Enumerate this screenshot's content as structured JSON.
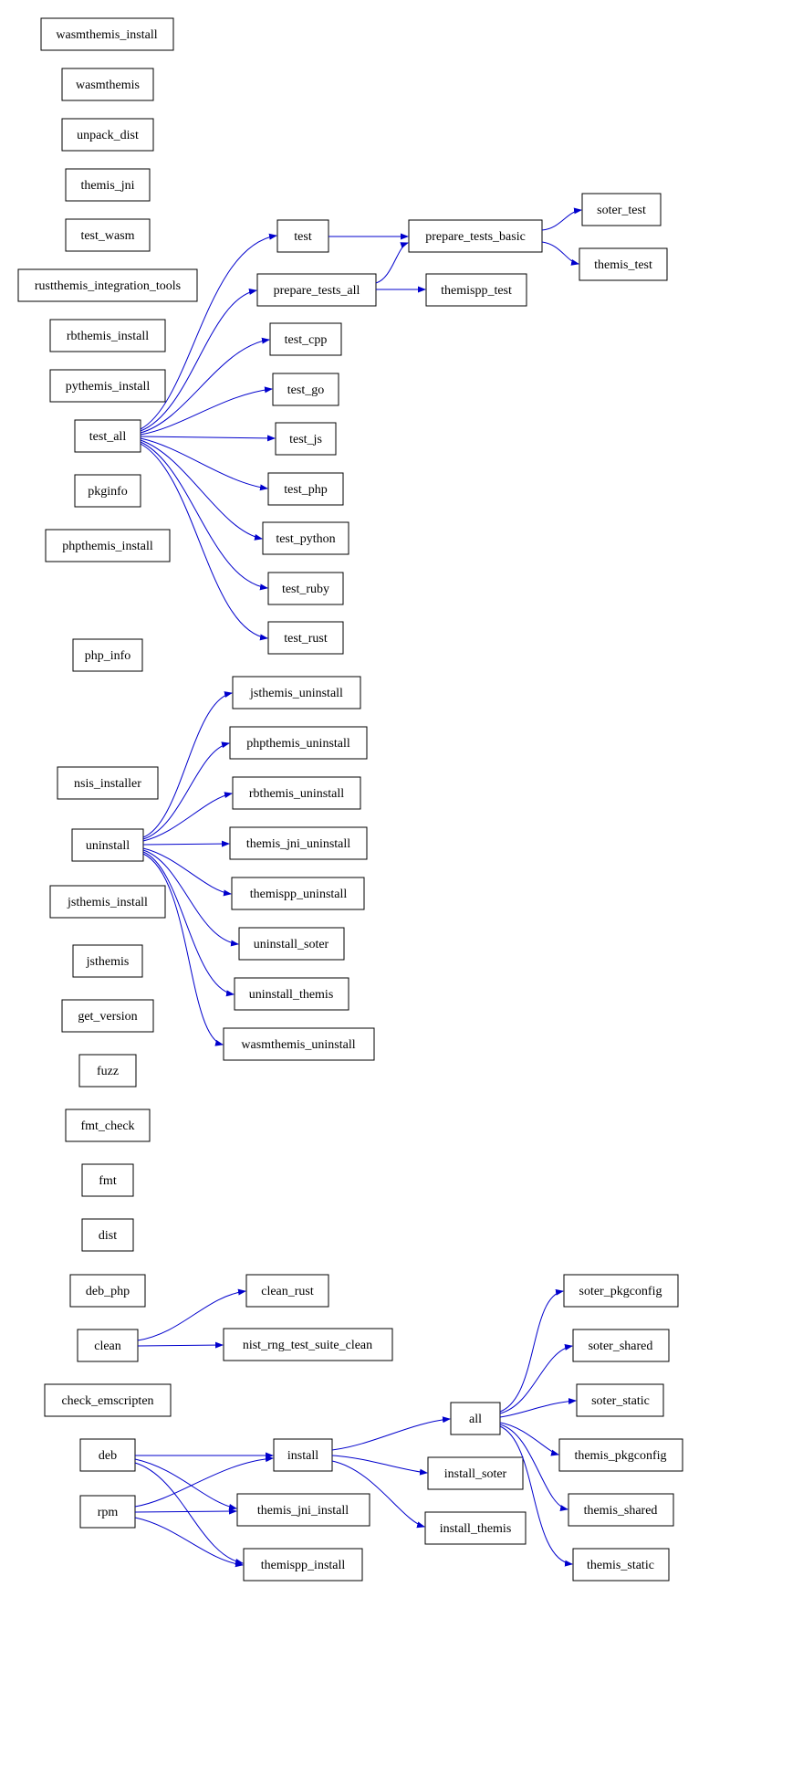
{
  "diagram_type": "dependency-graph",
  "nodes": {
    "wasmthemis_install": "wasmthemis_install",
    "wasmthemis": "wasmthemis",
    "unpack_dist": "unpack_dist",
    "themis_jni": "themis_jni",
    "test_wasm": "test_wasm",
    "rustthemis_integration_tools": "rustthemis_integration_tools",
    "rbthemis_install": "rbthemis_install",
    "pythemis_install": "pythemis_install",
    "test_all": "test_all",
    "pkginfo": "pkginfo",
    "phpthemis_install": "phpthemis_install",
    "test": "test",
    "prepare_tests_all": "prepare_tests_all",
    "test_cpp": "test_cpp",
    "test_go": "test_go",
    "test_js": "test_js",
    "test_php": "test_php",
    "test_python": "test_python",
    "test_ruby": "test_ruby",
    "test_rust": "test_rust",
    "prepare_tests_basic": "prepare_tests_basic",
    "themispp_test": "themispp_test",
    "soter_test": "soter_test",
    "themis_test": "themis_test",
    "php_info": "php_info",
    "nsis_installer": "nsis_installer",
    "uninstall": "uninstall",
    "jsthemis_install": "jsthemis_install",
    "jsthemis": "jsthemis",
    "get_version": "get_version",
    "fuzz": "fuzz",
    "fmt_check": "fmt_check",
    "fmt": "fmt",
    "dist": "dist",
    "deb_php": "deb_php",
    "clean": "clean",
    "check_emscripten": "check_emscripten",
    "deb": "deb",
    "rpm": "rpm",
    "jsthemis_uninstall": "jsthemis_uninstall",
    "phpthemis_uninstall": "phpthemis_uninstall",
    "rbthemis_uninstall": "rbthemis_uninstall",
    "themis_jni_uninstall": "themis_jni_uninstall",
    "themispp_uninstall": "themispp_uninstall",
    "uninstall_soter": "uninstall_soter",
    "uninstall_themis": "uninstall_themis",
    "wasmthemis_uninstall": "wasmthemis_uninstall",
    "clean_rust": "clean_rust",
    "nist_rng_test_suite_clean": "nist_rng_test_suite_clean",
    "install": "install",
    "themis_jni_install": "themis_jni_install",
    "themispp_install": "themispp_install",
    "all": "all",
    "install_soter": "install_soter",
    "install_themis": "install_themis",
    "soter_pkgconfig": "soter_pkgconfig",
    "soter_shared": "soter_shared",
    "soter_static": "soter_static",
    "themis_pkgconfig": "themis_pkgconfig",
    "themis_shared": "themis_shared",
    "themis_static": "themis_static"
  },
  "edges": [
    [
      "test_all",
      "test"
    ],
    [
      "test_all",
      "prepare_tests_all"
    ],
    [
      "test_all",
      "test_cpp"
    ],
    [
      "test_all",
      "test_go"
    ],
    [
      "test_all",
      "test_js"
    ],
    [
      "test_all",
      "test_php"
    ],
    [
      "test_all",
      "test_python"
    ],
    [
      "test_all",
      "test_ruby"
    ],
    [
      "test_all",
      "test_rust"
    ],
    [
      "test",
      "prepare_tests_basic"
    ],
    [
      "prepare_tests_all",
      "prepare_tests_basic"
    ],
    [
      "prepare_tests_all",
      "themispp_test"
    ],
    [
      "prepare_tests_basic",
      "soter_test"
    ],
    [
      "prepare_tests_basic",
      "themis_test"
    ],
    [
      "uninstall",
      "jsthemis_uninstall"
    ],
    [
      "uninstall",
      "phpthemis_uninstall"
    ],
    [
      "uninstall",
      "rbthemis_uninstall"
    ],
    [
      "uninstall",
      "themis_jni_uninstall"
    ],
    [
      "uninstall",
      "themispp_uninstall"
    ],
    [
      "uninstall",
      "uninstall_soter"
    ],
    [
      "uninstall",
      "uninstall_themis"
    ],
    [
      "uninstall",
      "wasmthemis_uninstall"
    ],
    [
      "clean",
      "clean_rust"
    ],
    [
      "clean",
      "nist_rng_test_suite_clean"
    ],
    [
      "deb",
      "install"
    ],
    [
      "deb",
      "themis_jni_install"
    ],
    [
      "deb",
      "themispp_install"
    ],
    [
      "rpm",
      "install"
    ],
    [
      "rpm",
      "themis_jni_install"
    ],
    [
      "rpm",
      "themispp_install"
    ],
    [
      "install",
      "all"
    ],
    [
      "install",
      "install_soter"
    ],
    [
      "install",
      "install_themis"
    ],
    [
      "all",
      "soter_pkgconfig"
    ],
    [
      "all",
      "soter_shared"
    ],
    [
      "all",
      "soter_static"
    ],
    [
      "all",
      "themis_pkgconfig"
    ],
    [
      "all",
      "themis_shared"
    ],
    [
      "all",
      "themis_static"
    ]
  ]
}
